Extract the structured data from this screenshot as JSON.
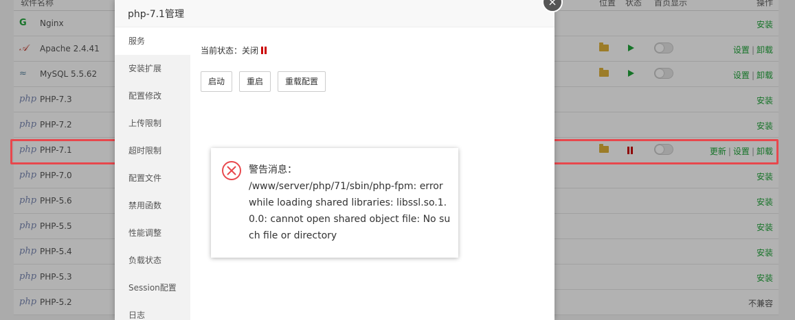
{
  "table": {
    "headers": {
      "name": "软件名称",
      "location": "位置",
      "status": "状态",
      "homepage": "首页显示",
      "ops": "操作"
    },
    "rows": [
      {
        "icon": "G",
        "name": "Nginx",
        "ops": [
          "安装"
        ]
      },
      {
        "icon": "𝒜",
        "name": "Apache 2.4.41",
        "ops": [
          "设置",
          "卸载"
        ]
      },
      {
        "icon": "≈",
        "name": "MySQL 5.5.62",
        "ops": [
          "设置",
          "卸载"
        ]
      },
      {
        "icon": "php",
        "name": "PHP-7.3",
        "ops": [
          "安装"
        ]
      },
      {
        "icon": "php",
        "name": "PHP-7.2",
        "ops": [
          "安装"
        ]
      },
      {
        "icon": "php",
        "name": "PHP-7.1",
        "ops": [
          "更新",
          "设置",
          "卸载"
        ]
      },
      {
        "icon": "php",
        "name": "PHP-7.0",
        "ops": [
          "安装"
        ]
      },
      {
        "icon": "php",
        "name": "PHP-5.6",
        "ops": [
          "安装"
        ]
      },
      {
        "icon": "php",
        "name": "PHP-5.5",
        "ops": [
          "安装"
        ]
      },
      {
        "icon": "php",
        "name": "PHP-5.4",
        "ops": [
          "安装"
        ]
      },
      {
        "icon": "php",
        "name": "PHP-5.3",
        "ops": [
          "安装"
        ]
      },
      {
        "icon": "php",
        "name": "PHP-5.2",
        "ops": [
          "不兼容"
        ]
      }
    ]
  },
  "modal": {
    "title": "php-7.1管理",
    "close": "×",
    "menu": [
      "服务",
      "安装扩展",
      "配置修改",
      "上传限制",
      "超时限制",
      "配置文件",
      "禁用函数",
      "性能调整",
      "负载状态",
      "Session配置",
      "日志"
    ],
    "state_label": "当前状态：关闭",
    "buttons": {
      "start": "启动",
      "restart": "重启",
      "reload": "重载配置"
    }
  },
  "alert": {
    "title": "警告消息：",
    "message": "/www/server/php/71/sbin/php-fpm: error while loading shared libraries: libssl.so.1.0.0: cannot open shared object file: No such file or directory"
  },
  "colors": {
    "accent_green": "#20a53a",
    "danger_red": "#cc0000",
    "highlight_red": "#e8474c"
  }
}
